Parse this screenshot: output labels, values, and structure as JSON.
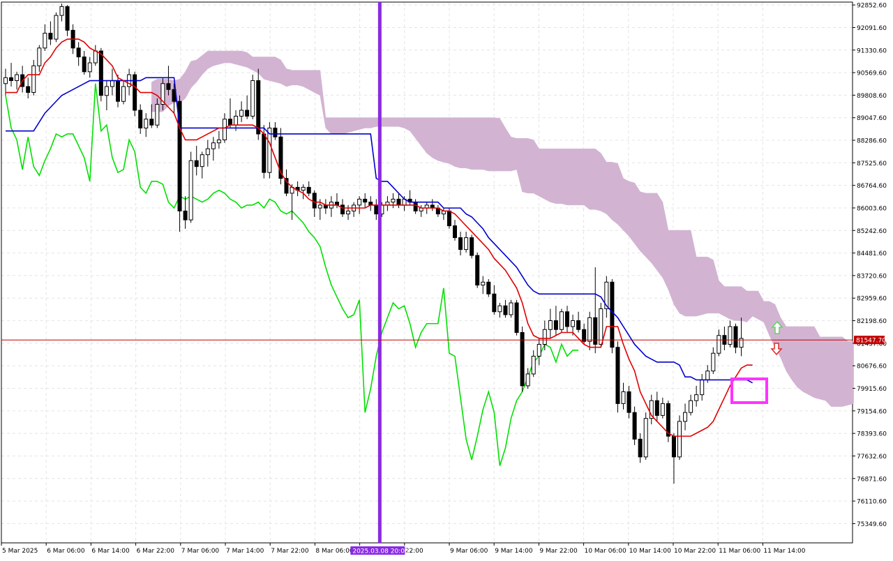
{
  "chart_data": {
    "type": "candlestick",
    "title": "",
    "price_axis": {
      "min": 74700,
      "max": 92950,
      "ticks": [
        75349.6,
        76110.6,
        76871.6,
        77632.6,
        78393.6,
        79154.6,
        79915.6,
        80676.6,
        81437.6,
        82198.6,
        82959.6,
        83720.6,
        84481.6,
        85242.6,
        86003.6,
        86764.6,
        87525.6,
        88286.6,
        89047.6,
        89808.6,
        90569.6,
        91330.6,
        92091.6,
        92852.6
      ],
      "tick_labels": [
        "75349.60",
        "76110.60",
        "76871.60",
        "77632.60",
        "78393.60",
        "79154.60",
        "79915.60",
        "80676.60",
        "81437.60",
        "82198.60",
        "82959.60",
        "83720.60",
        "84481.60",
        "85242.60",
        "86003.60",
        "86764.60",
        "87525.60",
        "88286.60",
        "89047.60",
        "89808.60",
        "90569.60",
        "91330.60",
        "92091.60",
        "92852.60"
      ]
    },
    "time_axis": {
      "labels": [
        "5 Mar 2025",
        "6 Mar 06:00",
        "6 Mar 14:00",
        "6 Mar 22:00",
        "7 Mar 06:00",
        "7 Mar 14:00",
        "7 Mar 22:00",
        "8 Mar 06:00",
        "8",
        "22:00",
        "9 Mar 06:00",
        "9 Mar 14:00",
        "9 Mar 22:00",
        "10 Mar 06:00",
        "10 Mar 14:00",
        "10 Mar 22:00",
        "11 Mar 06:00",
        "11 Mar 14:00"
      ]
    },
    "current_price": {
      "value": 81547.7,
      "label": "81547.70",
      "hidden_tick_label": "81437.60"
    },
    "vertical_marker": {
      "label": "2025.03.08 20:00",
      "bar_index": 67
    },
    "candles": [
      {
        "o": 90200,
        "h": 90700,
        "l": 89800,
        "c": 90400
      },
      {
        "o": 90400,
        "h": 90900,
        "l": 90100,
        "c": 90300
      },
      {
        "o": 90300,
        "h": 90600,
        "l": 90000,
        "c": 90500
      },
      {
        "o": 90500,
        "h": 90800,
        "l": 89900,
        "c": 90100
      },
      {
        "o": 90100,
        "h": 90400,
        "l": 89700,
        "c": 89900
      },
      {
        "o": 89900,
        "h": 91000,
        "l": 89800,
        "c": 90800
      },
      {
        "o": 90800,
        "h": 91500,
        "l": 90600,
        "c": 91400
      },
      {
        "o": 91400,
        "h": 92200,
        "l": 91300,
        "c": 91900
      },
      {
        "o": 91900,
        "h": 92300,
        "l": 91500,
        "c": 91700
      },
      {
        "o": 91700,
        "h": 92600,
        "l": 91600,
        "c": 92500
      },
      {
        "o": 92500,
        "h": 92900,
        "l": 92300,
        "c": 92800
      },
      {
        "o": 92800,
        "h": 92850,
        "l": 91800,
        "c": 92000
      },
      {
        "o": 92000,
        "h": 92200,
        "l": 91200,
        "c": 91400
      },
      {
        "o": 91400,
        "h": 91600,
        "l": 90800,
        "c": 91100
      },
      {
        "o": 91100,
        "h": 91300,
        "l": 90500,
        "c": 90600
      },
      {
        "o": 90600,
        "h": 91100,
        "l": 90400,
        "c": 90900
      },
      {
        "o": 90900,
        "h": 91500,
        "l": 90800,
        "c": 91300
      },
      {
        "o": 91300,
        "h": 91400,
        "l": 89600,
        "c": 89800
      },
      {
        "o": 89800,
        "h": 90300,
        "l": 89300,
        "c": 90100
      },
      {
        "o": 90100,
        "h": 90700,
        "l": 89800,
        "c": 90300
      },
      {
        "o": 90300,
        "h": 90500,
        "l": 89400,
        "c": 89600
      },
      {
        "o": 89600,
        "h": 90300,
        "l": 89500,
        "c": 90100
      },
      {
        "o": 90100,
        "h": 90700,
        "l": 89800,
        "c": 90500
      },
      {
        "o": 90500,
        "h": 90600,
        "l": 89100,
        "c": 89300
      },
      {
        "o": 89300,
        "h": 89500,
        "l": 88500,
        "c": 88700
      },
      {
        "o": 88700,
        "h": 89200,
        "l": 88400,
        "c": 89000
      },
      {
        "o": 89000,
        "h": 89500,
        "l": 88700,
        "c": 88800
      },
      {
        "o": 88800,
        "h": 89700,
        "l": 88700,
        "c": 89500
      },
      {
        "o": 89500,
        "h": 90400,
        "l": 89300,
        "c": 90200
      },
      {
        "o": 90200,
        "h": 90800,
        "l": 89800,
        "c": 90000
      },
      {
        "o": 90000,
        "h": 90200,
        "l": 89200,
        "c": 89600
      },
      {
        "o": 89600,
        "h": 89800,
        "l": 85200,
        "c": 85900
      },
      {
        "o": 85900,
        "h": 86400,
        "l": 85300,
        "c": 85600
      },
      {
        "o": 85600,
        "h": 87900,
        "l": 85500,
        "c": 87600
      },
      {
        "o": 87600,
        "h": 88100,
        "l": 87100,
        "c": 87400
      },
      {
        "o": 87400,
        "h": 87900,
        "l": 87000,
        "c": 87800
      },
      {
        "o": 87800,
        "h": 88300,
        "l": 87400,
        "c": 88000
      },
      {
        "o": 88000,
        "h": 88400,
        "l": 87600,
        "c": 88200
      },
      {
        "o": 88200,
        "h": 88600,
        "l": 88000,
        "c": 88300
      },
      {
        "o": 88300,
        "h": 89200,
        "l": 88200,
        "c": 89000
      },
      {
        "o": 89000,
        "h": 89700,
        "l": 88700,
        "c": 88800
      },
      {
        "o": 88800,
        "h": 89300,
        "l": 88600,
        "c": 89100
      },
      {
        "o": 89100,
        "h": 89600,
        "l": 88900,
        "c": 89300
      },
      {
        "o": 89300,
        "h": 89800,
        "l": 89000,
        "c": 89100
      },
      {
        "o": 89100,
        "h": 90500,
        "l": 89000,
        "c": 90300
      },
      {
        "o": 90300,
        "h": 90700,
        "l": 88300,
        "c": 88500
      },
      {
        "o": 88500,
        "h": 88800,
        "l": 87000,
        "c": 87200
      },
      {
        "o": 87200,
        "h": 88900,
        "l": 87000,
        "c": 88700
      },
      {
        "o": 88700,
        "h": 88900,
        "l": 88300,
        "c": 88400
      },
      {
        "o": 88400,
        "h": 88700,
        "l": 86800,
        "c": 87000
      },
      {
        "o": 87000,
        "h": 87300,
        "l": 86400,
        "c": 86500
      },
      {
        "o": 86500,
        "h": 86800,
        "l": 85600,
        "c": 86700
      },
      {
        "o": 86700,
        "h": 86900,
        "l": 86400,
        "c": 86600
      },
      {
        "o": 86600,
        "h": 86800,
        "l": 86300,
        "c": 86700
      },
      {
        "o": 86700,
        "h": 86900,
        "l": 86400,
        "c": 86500
      },
      {
        "o": 86500,
        "h": 86600,
        "l": 85700,
        "c": 86000
      },
      {
        "o": 86000,
        "h": 86300,
        "l": 85600,
        "c": 86100
      },
      {
        "o": 86100,
        "h": 86300,
        "l": 85800,
        "c": 86000
      },
      {
        "o": 86000,
        "h": 86400,
        "l": 85700,
        "c": 86200
      },
      {
        "o": 86200,
        "h": 86500,
        "l": 86000,
        "c": 86100
      },
      {
        "o": 86100,
        "h": 86300,
        "l": 85700,
        "c": 85800
      },
      {
        "o": 85800,
        "h": 86100,
        "l": 85600,
        "c": 85900
      },
      {
        "o": 85900,
        "h": 86200,
        "l": 85700,
        "c": 86100
      },
      {
        "o": 86100,
        "h": 86400,
        "l": 85800,
        "c": 86300
      },
      {
        "o": 86300,
        "h": 86500,
        "l": 86000,
        "c": 86200
      },
      {
        "o": 86200,
        "h": 86400,
        "l": 85900,
        "c": 86100
      },
      {
        "o": 86100,
        "h": 86300,
        "l": 85600,
        "c": 85800
      },
      {
        "o": 85800,
        "h": 86200,
        "l": 85700,
        "c": 86100
      },
      {
        "o": 86100,
        "h": 86400,
        "l": 85900,
        "c": 86200
      },
      {
        "o": 86200,
        "h": 86500,
        "l": 86000,
        "c": 86300
      },
      {
        "o": 86300,
        "h": 86500,
        "l": 86000,
        "c": 86100
      },
      {
        "o": 86100,
        "h": 86400,
        "l": 85900,
        "c": 86300
      },
      {
        "o": 86300,
        "h": 86600,
        "l": 86100,
        "c": 86200
      },
      {
        "o": 86200,
        "h": 86300,
        "l": 85800,
        "c": 85900
      },
      {
        "o": 85900,
        "h": 86100,
        "l": 85700,
        "c": 86000
      },
      {
        "o": 86000,
        "h": 86200,
        "l": 85800,
        "c": 86100
      },
      {
        "o": 86100,
        "h": 86300,
        "l": 85900,
        "c": 86000
      },
      {
        "o": 86000,
        "h": 86100,
        "l": 85700,
        "c": 85800
      },
      {
        "o": 85800,
        "h": 86000,
        "l": 85600,
        "c": 85900
      },
      {
        "o": 85900,
        "h": 86000,
        "l": 85300,
        "c": 85400
      },
      {
        "o": 85400,
        "h": 85600,
        "l": 84900,
        "c": 85000
      },
      {
        "o": 85000,
        "h": 85200,
        "l": 84400,
        "c": 84600
      },
      {
        "o": 84600,
        "h": 85200,
        "l": 84500,
        "c": 85000
      },
      {
        "o": 85000,
        "h": 85100,
        "l": 84300,
        "c": 84400
      },
      {
        "o": 84400,
        "h": 84500,
        "l": 83300,
        "c": 83400
      },
      {
        "o": 83400,
        "h": 83700,
        "l": 83100,
        "c": 83500
      },
      {
        "o": 83500,
        "h": 83600,
        "l": 83000,
        "c": 83100
      },
      {
        "o": 83100,
        "h": 83400,
        "l": 82400,
        "c": 82500
      },
      {
        "o": 82500,
        "h": 82800,
        "l": 82300,
        "c": 82700
      },
      {
        "o": 82700,
        "h": 82900,
        "l": 82300,
        "c": 82400
      },
      {
        "o": 82400,
        "h": 82900,
        "l": 82300,
        "c": 82800
      },
      {
        "o": 82800,
        "h": 82900,
        "l": 81700,
        "c": 81800
      },
      {
        "o": 81800,
        "h": 82000,
        "l": 79800,
        "c": 80000
      },
      {
        "o": 80000,
        "h": 80600,
        "l": 79900,
        "c": 80400
      },
      {
        "o": 80400,
        "h": 81200,
        "l": 80300,
        "c": 81000
      },
      {
        "o": 81000,
        "h": 81600,
        "l": 80700,
        "c": 81400
      },
      {
        "o": 81400,
        "h": 82200,
        "l": 81200,
        "c": 81900
      },
      {
        "o": 81900,
        "h": 82600,
        "l": 81600,
        "c": 82200
      },
      {
        "o": 82200,
        "h": 82700,
        "l": 81700,
        "c": 81900
      },
      {
        "o": 81900,
        "h": 82600,
        "l": 81800,
        "c": 82500
      },
      {
        "o": 82500,
        "h": 82700,
        "l": 81800,
        "c": 82000
      },
      {
        "o": 82000,
        "h": 82400,
        "l": 81700,
        "c": 82200
      },
      {
        "o": 82200,
        "h": 82500,
        "l": 81800,
        "c": 81900
      },
      {
        "o": 81900,
        "h": 82100,
        "l": 81400,
        "c": 81500
      },
      {
        "o": 81500,
        "h": 82500,
        "l": 81200,
        "c": 82300
      },
      {
        "o": 82300,
        "h": 84000,
        "l": 81100,
        "c": 81400
      },
      {
        "o": 81400,
        "h": 82800,
        "l": 81300,
        "c": 82600
      },
      {
        "o": 82600,
        "h": 83700,
        "l": 82300,
        "c": 83500
      },
      {
        "o": 83500,
        "h": 83600,
        "l": 81100,
        "c": 81300
      },
      {
        "o": 81300,
        "h": 81500,
        "l": 79100,
        "c": 79400
      },
      {
        "o": 79400,
        "h": 80100,
        "l": 79200,
        "c": 79800
      },
      {
        "o": 79800,
        "h": 80000,
        "l": 78900,
        "c": 79100
      },
      {
        "o": 79100,
        "h": 79300,
        "l": 78000,
        "c": 78200
      },
      {
        "o": 78200,
        "h": 78400,
        "l": 77400,
        "c": 77600
      },
      {
        "o": 77600,
        "h": 79100,
        "l": 77500,
        "c": 78900
      },
      {
        "o": 78900,
        "h": 79700,
        "l": 78700,
        "c": 79500
      },
      {
        "o": 79500,
        "h": 79800,
        "l": 78800,
        "c": 79000
      },
      {
        "o": 79000,
        "h": 79600,
        "l": 78900,
        "c": 79400
      },
      {
        "o": 79400,
        "h": 79500,
        "l": 78100,
        "c": 78300
      },
      {
        "o": 78300,
        "h": 78400,
        "l": 76700,
        "c": 77600
      },
      {
        "o": 77600,
        "h": 79000,
        "l": 77500,
        "c": 78800
      },
      {
        "o": 78800,
        "h": 79400,
        "l": 78500,
        "c": 79100
      },
      {
        "o": 79100,
        "h": 79700,
        "l": 79000,
        "c": 79500
      },
      {
        "o": 79500,
        "h": 80000,
        "l": 79300,
        "c": 79700
      },
      {
        "o": 79700,
        "h": 80400,
        "l": 79500,
        "c": 80200
      },
      {
        "o": 80200,
        "h": 80700,
        "l": 80100,
        "c": 80500
      },
      {
        "o": 80500,
        "h": 81300,
        "l": 80400,
        "c": 81100
      },
      {
        "o": 81100,
        "h": 81900,
        "l": 81000,
        "c": 81700
      },
      {
        "o": 81700,
        "h": 82000,
        "l": 81200,
        "c": 81400
      },
      {
        "o": 81400,
        "h": 82200,
        "l": 81300,
        "c": 82000
      },
      {
        "o": 82000,
        "h": 82100,
        "l": 81100,
        "c": 81300
      },
      {
        "o": 81300,
        "h": 82300,
        "l": 81000,
        "c": 81600
      }
    ],
    "tenkan": [
      89900,
      89900,
      89900,
      90300,
      90500,
      90500,
      90500,
      90900,
      91100,
      91400,
      91600,
      91700,
      91700,
      91700,
      91600,
      91400,
      91300,
      91200,
      91000,
      90800,
      90400,
      90300,
      90200,
      90100,
      89900,
      89900,
      89900,
      89800,
      89600,
      89400,
      89200,
      88700,
      88300,
      88300,
      88300,
      88400,
      88500,
      88600,
      88700,
      88700,
      88800,
      88800,
      88800,
      88800,
      88800,
      88700,
      88500,
      88200,
      87700,
      87200,
      86900,
      86700,
      86600,
      86500,
      86300,
      86200,
      86200,
      86100,
      86100,
      86100,
      86000,
      86000,
      86000,
      86000,
      86000,
      86100,
      86100,
      86100,
      86100,
      86100,
      86100,
      86100,
      86100,
      86100,
      86000,
      86000,
      86000,
      86000,
      85900,
      85900,
      85800,
      85600,
      85400,
      85200,
      85000,
      84800,
      84600,
      84300,
      84100,
      83900,
      83600,
      83300,
      82800,
      82100,
      81700,
      81600,
      81600,
      81600,
      81700,
      81800,
      81800,
      81800,
      81600,
      81400,
      81300,
      81300,
      81300,
      82000,
      82000,
      82000,
      81400,
      80900,
      80500,
      79800,
      79400,
      79000,
      78800,
      78600,
      78400,
      78300,
      78300,
      78300,
      78300,
      78400,
      78500,
      78600,
      78800,
      79200,
      79600,
      80000,
      80300,
      80600,
      80700,
      80700
    ],
    "kijun": [
      88600,
      88600,
      88600,
      88600,
      88600,
      88600,
      88900,
      89200,
      89400,
      89600,
      89800,
      89900,
      90000,
      90100,
      90200,
      90300,
      90300,
      90300,
      90300,
      90300,
      90300,
      90300,
      90300,
      90300,
      90300,
      90400,
      90400,
      90400,
      90400,
      90400,
      90400,
      88700,
      88700,
      88700,
      88700,
      88700,
      88700,
      88700,
      88700,
      88700,
      88700,
      88700,
      88700,
      88700,
      88700,
      88700,
      88700,
      88500,
      88500,
      88500,
      88500,
      88500,
      88500,
      88500,
      88500,
      88500,
      88500,
      88500,
      88500,
      88500,
      88500,
      88500,
      88500,
      88500,
      88500,
      88500,
      87000,
      86900,
      86900,
      86700,
      86500,
      86300,
      86200,
      86200,
      86200,
      86200,
      86200,
      86200,
      86000,
      86000,
      86000,
      86000,
      85800,
      85700,
      85500,
      85300,
      85000,
      84800,
      84600,
      84400,
      84200,
      84000,
      83700,
      83400,
      83200,
      83100,
      83100,
      83100,
      83100,
      83100,
      83100,
      83100,
      83100,
      83100,
      83100,
      83100,
      83000,
      82700,
      82500,
      82300,
      82000,
      81700,
      81400,
      81200,
      81000,
      80900,
      80800,
      80800,
      80800,
      80800,
      80700,
      80300,
      80300,
      80200,
      80200,
      80200,
      80200,
      80200,
      80200,
      80200,
      80200,
      80200,
      80200,
      80100
    ],
    "chikou": [
      89800,
      88700,
      88300,
      87300,
      88400,
      87400,
      87100,
      87600,
      88000,
      88500,
      88400,
      88500,
      88500,
      88100,
      87700,
      86900,
      90200,
      88600,
      88800,
      87700,
      87200,
      87300,
      88300,
      87900,
      86700,
      86500,
      86900,
      86900,
      86800,
      86200,
      86000,
      86400,
      86300,
      86400,
      86300,
      86200,
      86300,
      86500,
      86600,
      86500,
      86300,
      86200,
      86000,
      86100,
      86100,
      86200,
      86000,
      86300,
      86200,
      85900,
      85800,
      85900,
      85700,
      85500,
      85200,
      85000,
      84700,
      84000,
      83400,
      83000,
      82600,
      82300,
      82400,
      82900,
      79100,
      79900,
      81000,
      81800,
      82300,
      82800,
      82600,
      82700,
      82100,
      81300,
      81800,
      82100,
      82100,
      82100,
      83300,
      81100,
      81000,
      79600,
      78200,
      77500,
      78300,
      79200,
      79800,
      79100,
      77300,
      77900,
      78900,
      79500,
      79800,
      80300,
      80800,
      81000,
      81400,
      81300,
      80800,
      81400,
      81000,
      81200,
      81200
    ]
  },
  "legend_arrows": {
    "up_color": "#5cd65c",
    "down_color": "#e02828"
  },
  "colors": {
    "bull_body": "#ffffff",
    "bear_body": "#000000",
    "wick": "#000000",
    "tenkan": "#e00000",
    "kijun": "#0000cc",
    "chikou": "#00e000",
    "cloud_bear": "#d2b4d2",
    "cloud_bull": "#f4a460",
    "marker": "#8a2be2",
    "price_line": "#c00000",
    "highlight_box": "#ff33ff",
    "tenkan_overlay": "#ff69b4",
    "kijun_overlay": "#2e6b4f"
  }
}
